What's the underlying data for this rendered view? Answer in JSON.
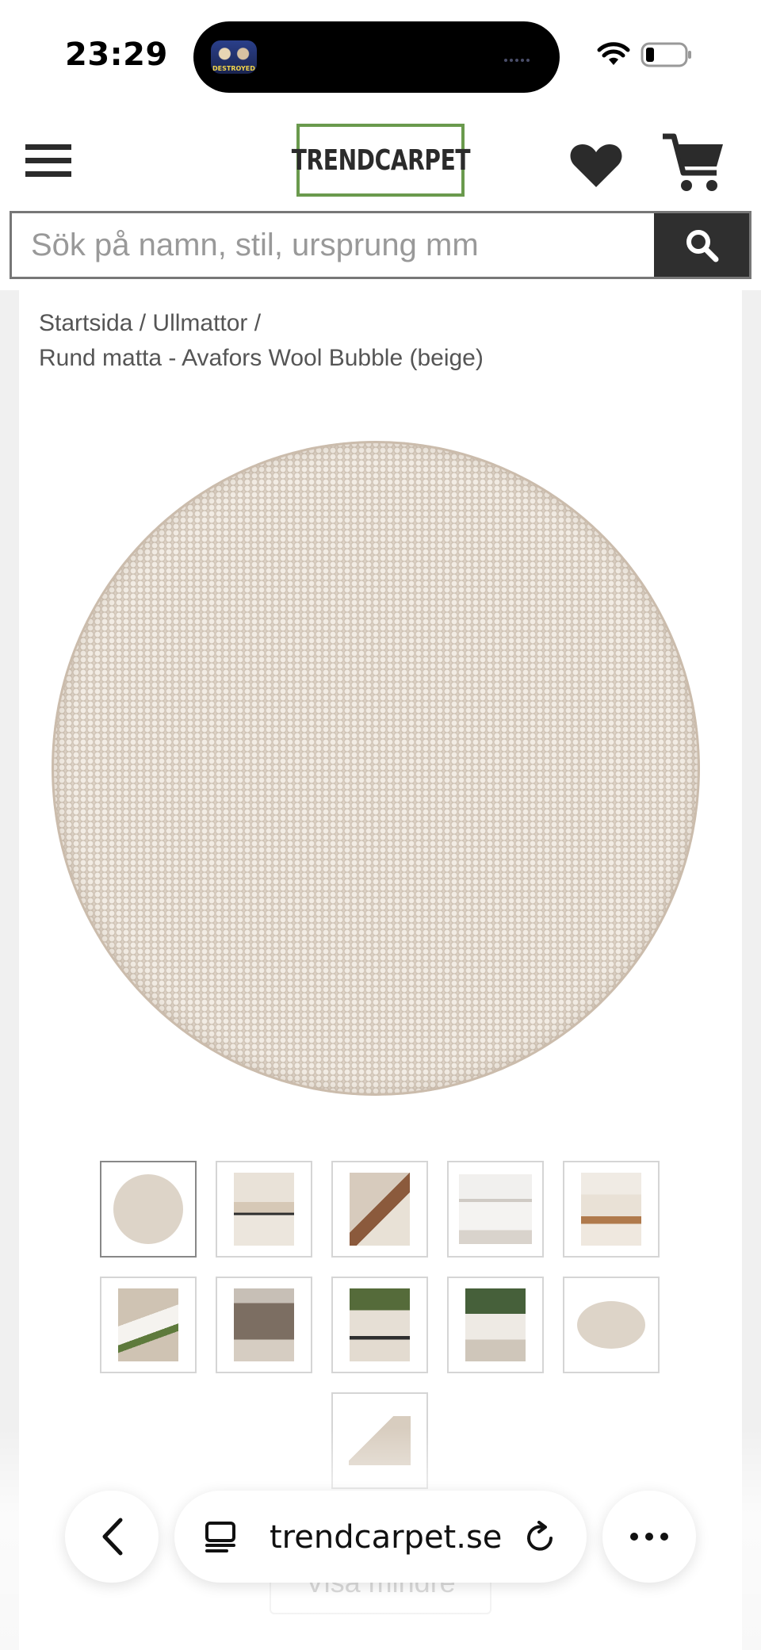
{
  "status_bar": {
    "time": "23:29",
    "island_thumb_text": "DESTROYED"
  },
  "header": {
    "logo": "TRENDCARPET",
    "logo_border_color": "#6a9a4d"
  },
  "search": {
    "placeholder": "Sök på namn, stil, ursprung mm"
  },
  "breadcrumb": {
    "home": "Startsida",
    "separator": " / ",
    "category": "Ullmattor",
    "product": "Rund matta - Avafors Wool Bubble (beige)"
  },
  "gallery": {
    "thumbnails": [
      {
        "icon": "round-rug"
      },
      {
        "icon": "living-room"
      },
      {
        "icon": "rug-corner"
      },
      {
        "icon": "console-room"
      },
      {
        "icon": "stool-room"
      },
      {
        "icon": "plant-closeup"
      },
      {
        "icon": "armchair"
      },
      {
        "icon": "sofa-plants"
      },
      {
        "icon": "window-plant"
      },
      {
        "icon": "oval-rug"
      },
      {
        "icon": "rug-detail"
      }
    ]
  },
  "show_less_label": "Visa mindre",
  "browser": {
    "url": "trendcarpet.se"
  }
}
